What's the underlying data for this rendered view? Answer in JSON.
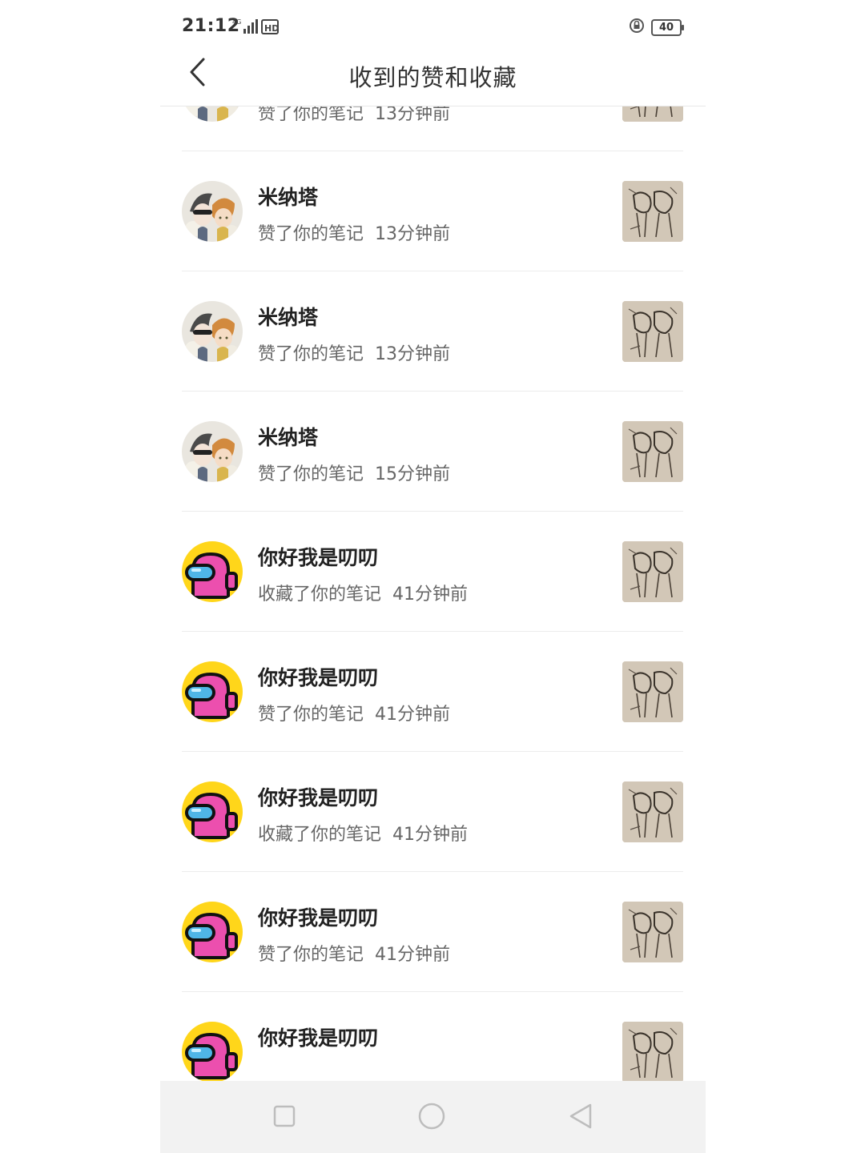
{
  "status_bar": {
    "time": "21:12",
    "network": "4G",
    "hd": "HD",
    "battery": "40"
  },
  "header": {
    "back_icon": "chevron-left-icon",
    "title": "收到的赞和收藏"
  },
  "list": {
    "items": [
      {
        "user": "米纳塔",
        "avatar": "anime-avatar",
        "action": "赞了你的笔记",
        "time": "13分钟前"
      },
      {
        "user": "米纳塔",
        "avatar": "anime-avatar",
        "action": "赞了你的笔记",
        "time": "13分钟前"
      },
      {
        "user": "米纳塔",
        "avatar": "anime-avatar",
        "action": "赞了你的笔记",
        "time": "13分钟前"
      },
      {
        "user": "米纳塔",
        "avatar": "anime-avatar",
        "action": "赞了你的笔记",
        "time": "15分钟前"
      },
      {
        "user": "你好我是叨叨",
        "avatar": "crewmate-avatar",
        "action": "收藏了你的笔记",
        "time": "41分钟前"
      },
      {
        "user": "你好我是叨叨",
        "avatar": "crewmate-avatar",
        "action": "赞了你的笔记",
        "time": "41分钟前"
      },
      {
        "user": "你好我是叨叨",
        "avatar": "crewmate-avatar",
        "action": "收藏了你的笔记",
        "time": "41分钟前"
      },
      {
        "user": "你好我是叨叨",
        "avatar": "crewmate-avatar",
        "action": "赞了你的笔记",
        "time": "41分钟前"
      },
      {
        "user": "你好我是叨叨",
        "avatar": "crewmate-avatar",
        "action": "",
        "time": ""
      }
    ]
  },
  "system_nav": {
    "recent_icon": "square-icon",
    "home_icon": "circle-icon",
    "back_icon": "triangle-back-icon"
  }
}
